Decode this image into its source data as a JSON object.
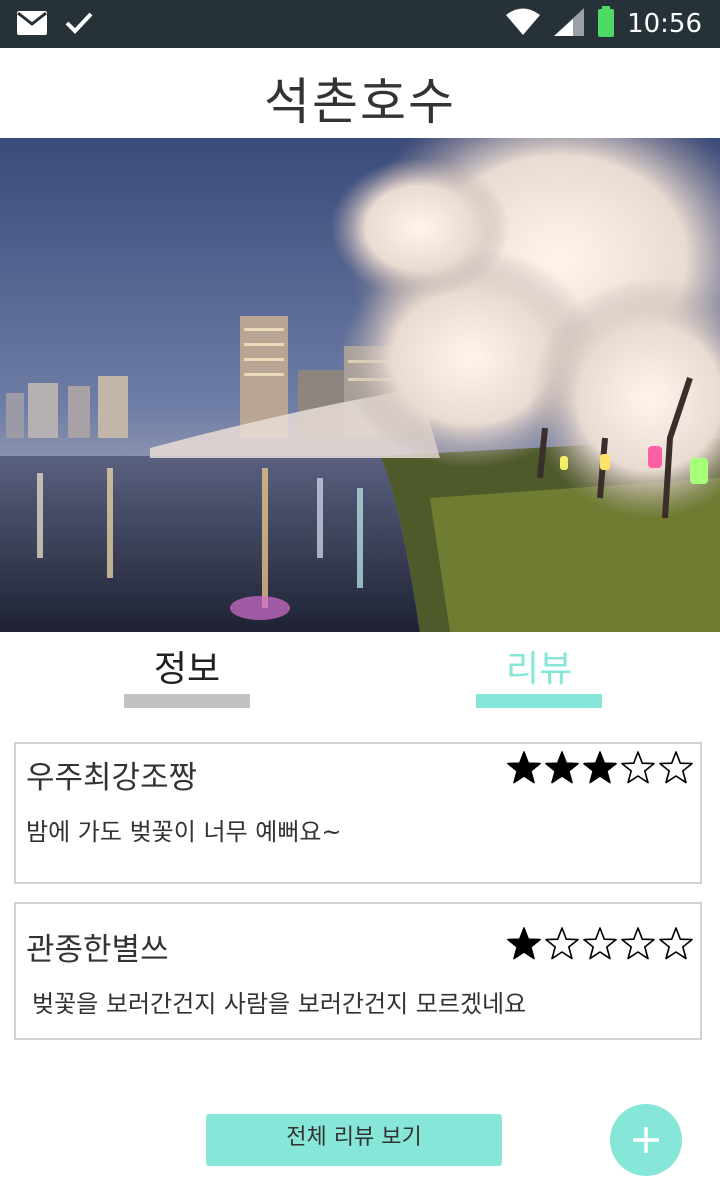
{
  "status_bar": {
    "time": "10:56",
    "icons": [
      "mail-icon",
      "check-icon",
      "wifi-icon",
      "signal-icon",
      "battery-icon"
    ]
  },
  "header": {
    "title": "석촌호수"
  },
  "hero": {
    "image": "night view of lake with cherry blossoms and city buildings"
  },
  "tabs": [
    {
      "label": "정보",
      "active": false
    },
    {
      "label": "리뷰",
      "active": true
    }
  ],
  "reviews": [
    {
      "author": "우주최강조짱",
      "rating": 3,
      "max_rating": 5,
      "content": "밤에 가도 벚꽃이 너무 예뻐요~"
    },
    {
      "author": "관종한별쓰",
      "rating": 1,
      "max_rating": 5,
      "content": "벚꽃을 보러간건지 사람을 보러간건지  모르겠네요"
    }
  ],
  "actions": {
    "view_all_label": "전체 리뷰 보기",
    "fab_icon": "plus-icon"
  },
  "colors": {
    "accent": "#86e6d8",
    "status_bar": "#263238",
    "tab_inactive_line": "#c2c2c2",
    "battery": "#4cd964"
  }
}
